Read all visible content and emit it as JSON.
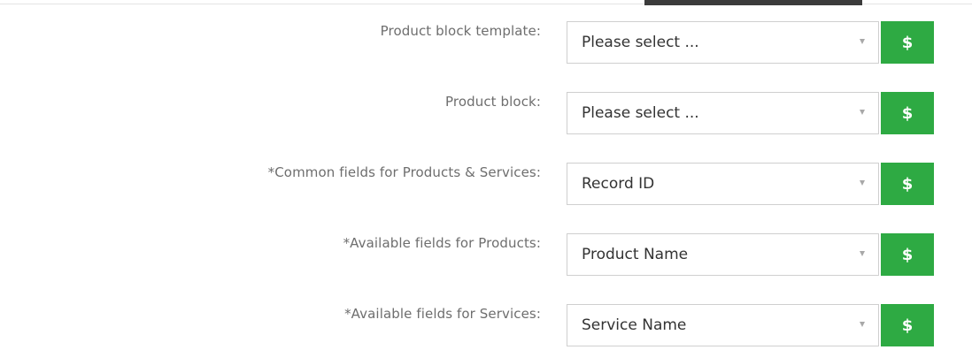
{
  "rows": [
    {
      "label": "Product block template:",
      "value": "Please select ..."
    },
    {
      "label": "Product block:",
      "value": "Please select ..."
    },
    {
      "label": "*Common fields for Products & Services:",
      "value": "Record ID"
    },
    {
      "label": "*Available fields for Products:",
      "value": "Product Name"
    },
    {
      "label": "*Available fields for Services:",
      "value": "Service Name"
    }
  ],
  "button_glyph": "$",
  "icons": {
    "caret": "chevron-down-icon",
    "button": "dollar-icon"
  },
  "colors": {
    "button_bg": "#2eaa43",
    "label_text": "#6e6e6e",
    "value_text": "#333333",
    "select_border": "#cfcfcf"
  }
}
